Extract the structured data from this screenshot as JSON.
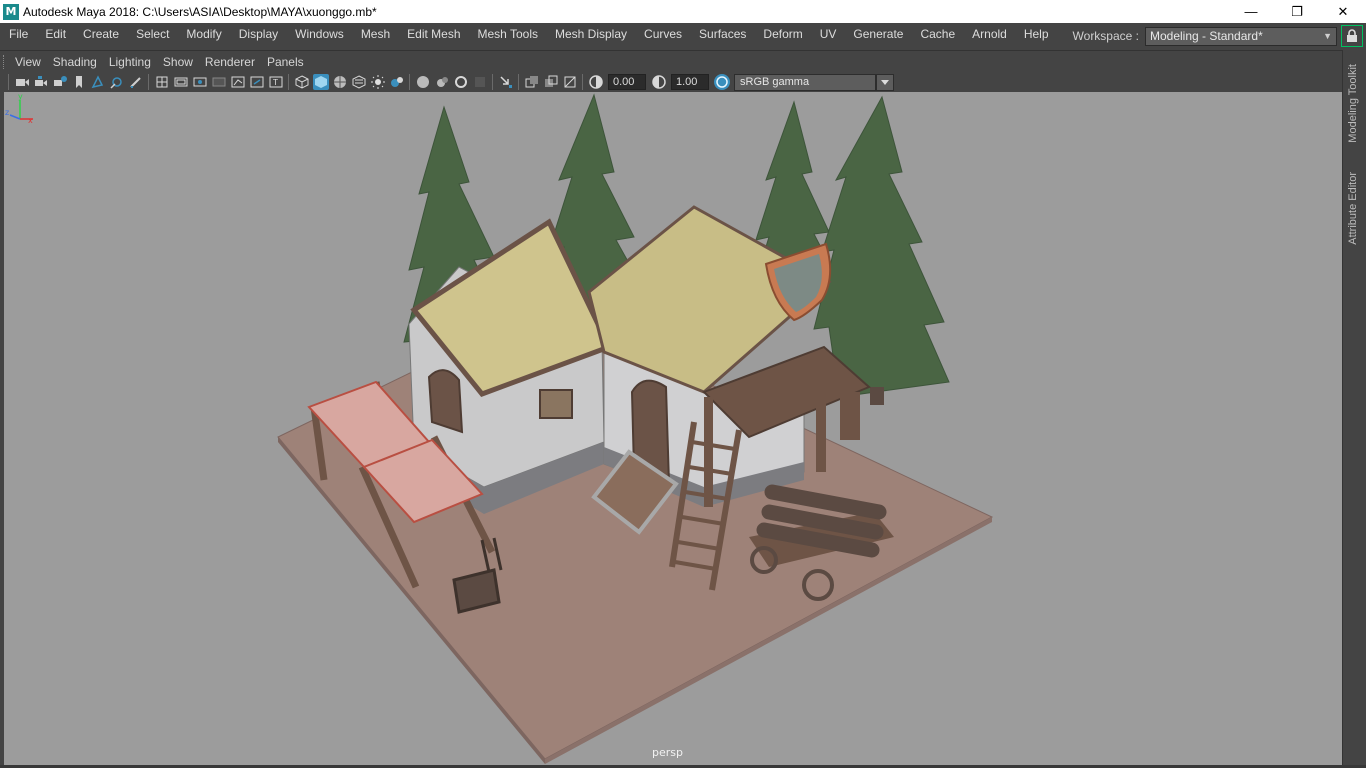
{
  "window": {
    "app_icon": "M",
    "title": "Autodesk Maya 2018: C:\\Users\\ASIA\\Desktop\\MAYA\\xuonggo.mb*",
    "minimize": "—",
    "restore": "❐",
    "close": "✕"
  },
  "menubar": {
    "items": [
      "File",
      "Edit",
      "Create",
      "Select",
      "Modify",
      "Display",
      "Windows",
      "Mesh",
      "Edit Mesh",
      "Mesh Tools",
      "Mesh Display",
      "Curves",
      "Surfaces",
      "Deform",
      "UV",
      "Generate",
      "Cache",
      "Arnold",
      "Help"
    ]
  },
  "workspace": {
    "label": "Workspace :",
    "value": "Modeling - Standard*"
  },
  "panel_menu": {
    "items": [
      "View",
      "Shading",
      "Lighting",
      "Show",
      "Renderer",
      "Panels"
    ]
  },
  "toolbar": {
    "exposure": "0.00",
    "gamma": "1.00",
    "color_space": "sRGB gamma",
    "icons": [
      "camera-icon",
      "lock-camera-icon",
      "bookmark-icon",
      "image-plane-icon",
      "grid-icon",
      "film-gate-icon",
      "resolution-gate-icon",
      "gate-mask-icon",
      "field-chart-icon",
      "safe-action-icon",
      "wireframe-icon",
      "smooth-shade-icon",
      "shaded-wireframe-icon",
      "textured-icon",
      "lights-icon",
      "shadows-icon",
      "isolate-icon",
      "xray-icon",
      "exposure-icon",
      "gamma-icon",
      "color-management-icon"
    ]
  },
  "viewport": {
    "camera": "persp",
    "axis_x": "x",
    "axis_y": "y",
    "axis_z": "z"
  },
  "right_dock": {
    "tabs": [
      "Modeling Toolkit",
      "Attribute Editor"
    ]
  },
  "colors": {
    "ui_bg": "#444444",
    "viewport_bg": "#9c9c9c",
    "accent_active": "#3a8fbd",
    "lock_border": "#00c060"
  }
}
